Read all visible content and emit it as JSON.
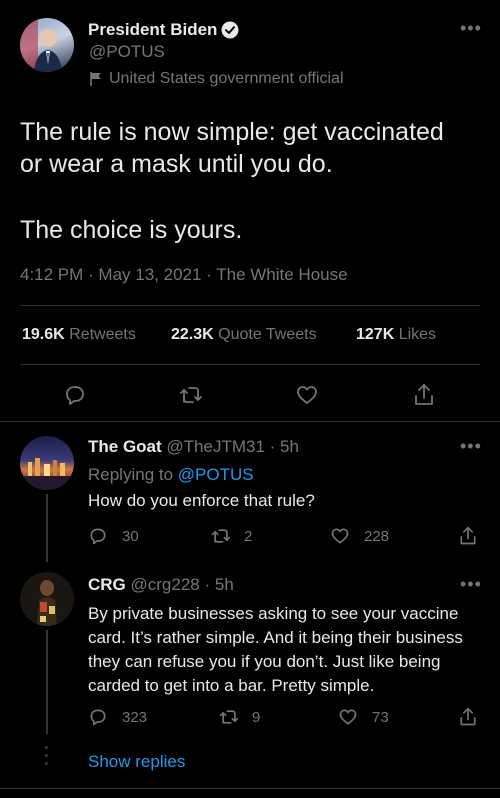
{
  "main_tweet": {
    "author_name": "President Biden",
    "handle": "@POTUS",
    "affiliation": "United States government official",
    "text_line1": "The rule is now simple: get vaccinated",
    "text_line2": "or wear a mask until you do.",
    "text_line3": "The choice is yours.",
    "meta": "4:12 PM · May 13, 2021 · The White House",
    "stats": {
      "retweets_count": "19.6K",
      "retweets_label": "Retweets",
      "quotes_count": "22.3K",
      "quotes_label": "Quote Tweets",
      "likes_count": "127K",
      "likes_label": "Likes"
    }
  },
  "replies": [
    {
      "name": "The Goat",
      "handle_time": "@TheJTM31 · 5h",
      "replying_prefix": "Replying to",
      "replying_to": "@POTUS",
      "text": "How do you enforce that rule?",
      "reply_count": "30",
      "retweet_count": "2",
      "like_count": "228"
    },
    {
      "name": "CRG",
      "handle_time": "@crg228 · 5h",
      "text_line1": "By private businesses asking to see your vaccine",
      "text_line2": "card. It’s rather simple. And it being their business",
      "text_line3": "they can refuse you if you don’t. Just like being",
      "text_line4": "carded to get into a bar. Pretty simple.",
      "reply_count": "323",
      "retweet_count": "9",
      "like_count": "73"
    }
  ],
  "show_replies_label": "Show replies",
  "colors": {
    "accent": "#1d9bf0",
    "muted": "#71767b",
    "background": "#000000"
  }
}
